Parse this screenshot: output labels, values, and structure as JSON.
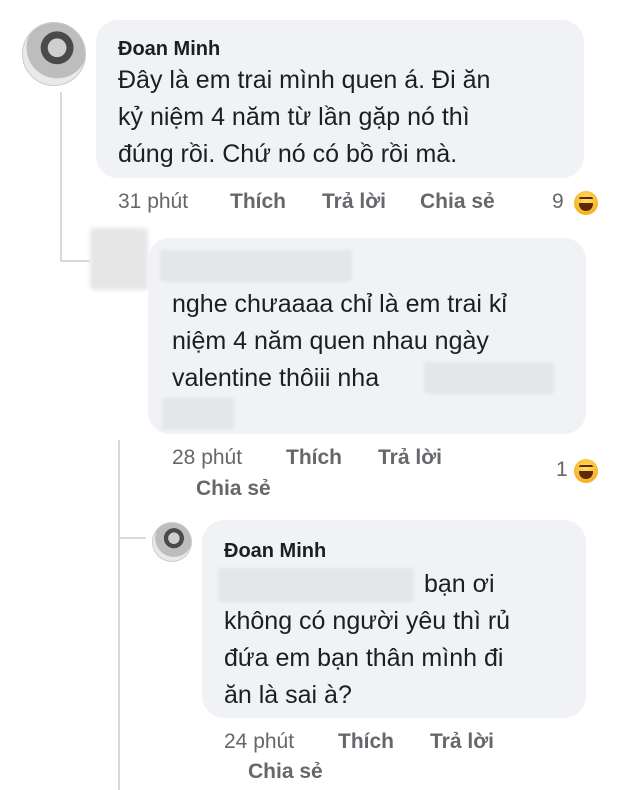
{
  "comment1": {
    "author": "Đoan Minh",
    "lines": [
      "Đây là em trai mình quen á. Đi ăn",
      "kỷ niệm 4 năm từ lần gặp nó thì",
      "đúng rồi. Chứ nó có bồ rồi mà."
    ],
    "time": "31 phút",
    "like": "Thích",
    "reply": "Trả lời",
    "share": "Chia sẻ",
    "reaction_count": "9",
    "reaction_icon": "haha-emoji-icon"
  },
  "comment2": {
    "lines": [
      "nghe chưaaaa chỉ là em trai kỉ",
      "niệm 4 năm quen nhau ngày",
      "valentine thôiii nha"
    ],
    "time": "28 phút",
    "like": "Thích",
    "reply": "Trả lời",
    "share": "Chia sẻ",
    "reaction_count": "1",
    "reaction_icon": "haha-emoji-icon"
  },
  "comment3": {
    "author": "Đoan Minh",
    "lines": [
      "bạn ơi",
      "không có người yêu thì rủ",
      "đứa em bạn thân mình đi",
      "ăn là sai à?"
    ],
    "time": "24 phút",
    "like": "Thích",
    "reply": "Trả lời",
    "share": "Chia sẻ"
  }
}
